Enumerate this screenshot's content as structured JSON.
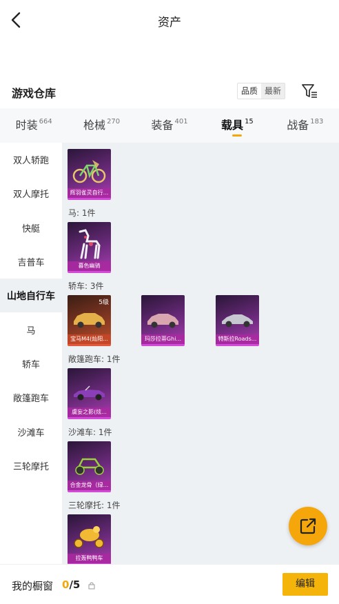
{
  "header": {
    "title": "资产"
  },
  "warehouse": {
    "title": "游戏仓库",
    "sort_options": [
      "品质",
      "最新"
    ],
    "sort_selected": "最新"
  },
  "tabs": [
    {
      "label": "时装",
      "count": "664",
      "active": false
    },
    {
      "label": "枪械",
      "count": "270",
      "active": false
    },
    {
      "label": "装备",
      "count": "401",
      "active": false
    },
    {
      "label": "载具",
      "count": "15",
      "active": true
    },
    {
      "label": "战备",
      "count": "183",
      "active": false
    }
  ],
  "sidebar": {
    "items": [
      {
        "label": "双人轿跑",
        "active": false
      },
      {
        "label": "双人摩托",
        "active": false
      },
      {
        "label": "快艇",
        "active": false
      },
      {
        "label": "吉普车",
        "active": false
      },
      {
        "label": "山地自行车",
        "active": true
      },
      {
        "label": "马",
        "active": false
      },
      {
        "label": "轿车",
        "active": false
      },
      {
        "label": "敞篷跑车",
        "active": false
      },
      {
        "label": "沙滩车",
        "active": false
      },
      {
        "label": "三轮摩托",
        "active": false
      }
    ]
  },
  "groups": {
    "bike": {
      "items": [
        {
          "name": "辉羽雀灵自行...",
          "icon": "bicycle-icon"
        }
      ]
    },
    "horse": {
      "label": "马: 1件",
      "items": [
        {
          "name": "暮色幽骑",
          "icon": "horse-icon"
        }
      ]
    },
    "sedan": {
      "label": "轿车: 3件",
      "items": [
        {
          "name": "宝马M4(灿阳...",
          "level": "5级",
          "icon": "car-icon"
        },
        {
          "name": "玛莎拉蒂Ghi...",
          "icon": "car-icon"
        },
        {
          "name": "特斯拉Roads...",
          "icon": "car-icon"
        }
      ]
    },
    "convertible": {
      "label": "敞篷跑车: 1件",
      "items": [
        {
          "name": "虞妄之影(炫...",
          "icon": "car-icon"
        }
      ]
    },
    "buggy": {
      "label": "沙滩车: 1件",
      "items": [
        {
          "name": "合金龙骨（绿...",
          "icon": "buggy-icon"
        }
      ]
    },
    "trike": {
      "label": "三轮摩托: 1件",
      "items": [
        {
          "name": "拉轰鸭鸭车",
          "icon": "trike-icon"
        }
      ]
    }
  },
  "bottom": {
    "window_label": "我的橱窗",
    "window_current": "0",
    "window_sep": "/",
    "window_max": "5",
    "edit_label": "编辑"
  },
  "colors": {
    "accent": "#f5a60a",
    "card_purple": "#a83cb0",
    "card_orange": "#b8502b"
  }
}
